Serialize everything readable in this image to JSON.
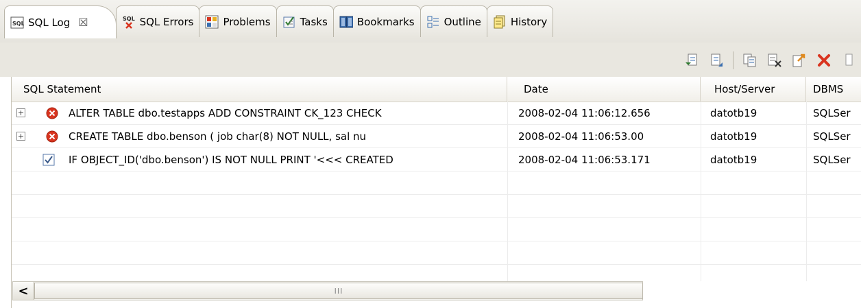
{
  "tabs": [
    {
      "label": "SQL Log",
      "icon": "sql-log-icon",
      "active": true,
      "close_glyph": "☒"
    },
    {
      "label": "SQL Errors",
      "icon": "sql-errors-icon"
    },
    {
      "label": "Problems",
      "icon": "problems-icon"
    },
    {
      "label": "Tasks",
      "icon": "tasks-icon"
    },
    {
      "label": "Bookmarks",
      "icon": "bookmarks-icon"
    },
    {
      "label": "Outline",
      "icon": "outline-icon"
    },
    {
      "label": "History",
      "icon": "history-icon"
    }
  ],
  "toolbar": {
    "icons": [
      "expand-all-icon",
      "collapse-all-icon",
      "copy-icon",
      "clear-icon",
      "export-icon",
      "delete-icon",
      "overflow-icon"
    ]
  },
  "table": {
    "columns": [
      "SQL Statement",
      "Date",
      "Host/Server",
      "DBMS"
    ],
    "rows": [
      {
        "status": "error",
        "expandable": true,
        "sql": "ALTER TABLE dbo.testapps    ADD CONSTRAINT CK_123    CHECK",
        "date": "2008-02-04 11:06:12.656",
        "host": "datotb19",
        "dbms": "SQLSer"
      },
      {
        "status": "error",
        "expandable": true,
        "sql": "CREATE TABLE dbo.benson (     job char(8)       NOT NULL,      sal nu",
        "date": "2008-02-04 11:06:53.00",
        "host": "datotb19",
        "dbms": "SQLSer"
      },
      {
        "status": "success",
        "expandable": false,
        "sql": "IF OBJECT_ID('dbo.benson') IS NOT NULL    PRINT '<<< CREATED",
        "date": "2008-02-04 11:06:53.171",
        "host": "datotb19",
        "dbms": "SQLSer"
      }
    ]
  },
  "scrollbar": {
    "left_arrow": "<",
    "grip": "III"
  },
  "colors": {
    "error": "#d9341f",
    "accent": "#3a6fb0"
  }
}
